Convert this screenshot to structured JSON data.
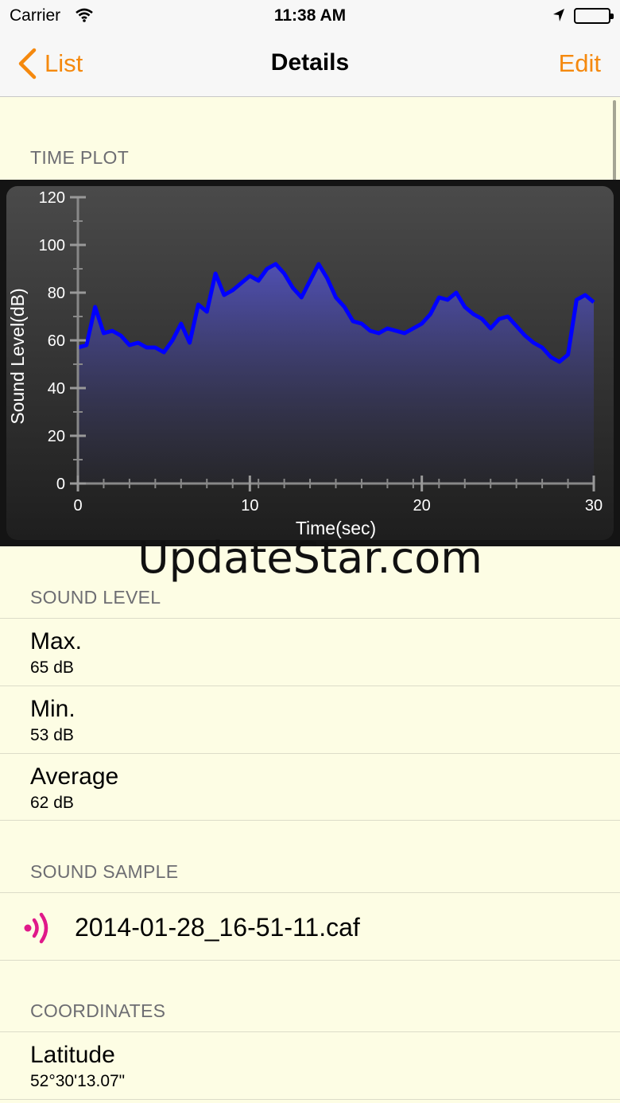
{
  "status_bar": {
    "carrier": "Carrier",
    "time": "11:38 AM"
  },
  "nav": {
    "back_label": "List",
    "title": "Details",
    "edit_label": "Edit"
  },
  "sections": {
    "time_plot": "TIME PLOT",
    "sound_level": "SOUND LEVEL",
    "sound_sample": "SOUND SAMPLE",
    "coordinates": "COORDINATES"
  },
  "sound_level": {
    "max_label": "Max.",
    "max_value": "65 dB",
    "min_label": "Min.",
    "min_value": "53 dB",
    "avg_label": "Average",
    "avg_value": "62 dB"
  },
  "sound_sample": {
    "file_name": "2014-01-28_16-51-11.caf"
  },
  "coordinates": {
    "latitude_label": "Latitude",
    "latitude_value": "52°30'13.07\""
  },
  "watermark": "UpdateStar.com",
  "colors": {
    "accent": "#f5890e",
    "line": "#0000ff",
    "sample_icon": "#e0198a"
  },
  "chart_data": {
    "type": "area",
    "xlabel": "Time(sec)",
    "ylabel": "Sound Level(dB)",
    "xlim": [
      0,
      30
    ],
    "ylim": [
      0,
      120
    ],
    "x_ticks": [
      0,
      10,
      20,
      30
    ],
    "y_ticks": [
      0,
      20,
      40,
      60,
      80,
      100,
      120
    ],
    "x": [
      0,
      0.5,
      1,
      1.5,
      2,
      2.5,
      3,
      3.5,
      4,
      4.5,
      5,
      5.5,
      6,
      6.5,
      7,
      7.5,
      8,
      8.5,
      9,
      9.5,
      10,
      10.5,
      11,
      11.5,
      12,
      12.5,
      13,
      13.5,
      14,
      14.5,
      15,
      15.5,
      16,
      16.5,
      17,
      17.5,
      18,
      18.5,
      19,
      19.5,
      20,
      20.5,
      21,
      21.5,
      22,
      22.5,
      23,
      23.5,
      24,
      24.5,
      25,
      25.5,
      26,
      26.5,
      27,
      27.5,
      28,
      28.5,
      29,
      29.5,
      30
    ],
    "y": [
      57,
      58,
      74,
      63,
      64,
      62,
      58,
      59,
      57,
      57,
      55,
      60,
      67,
      59,
      75,
      72,
      88,
      79,
      81,
      84,
      87,
      85,
      90,
      92,
      88,
      82,
      78,
      85,
      92,
      86,
      78,
      74,
      68,
      67,
      64,
      63,
      65,
      64,
      63,
      65,
      67,
      71,
      78,
      77,
      80,
      74,
      71,
      69,
      65,
      69,
      70,
      66,
      62,
      59,
      57,
      53,
      51,
      54,
      77,
      79,
      76
    ]
  }
}
